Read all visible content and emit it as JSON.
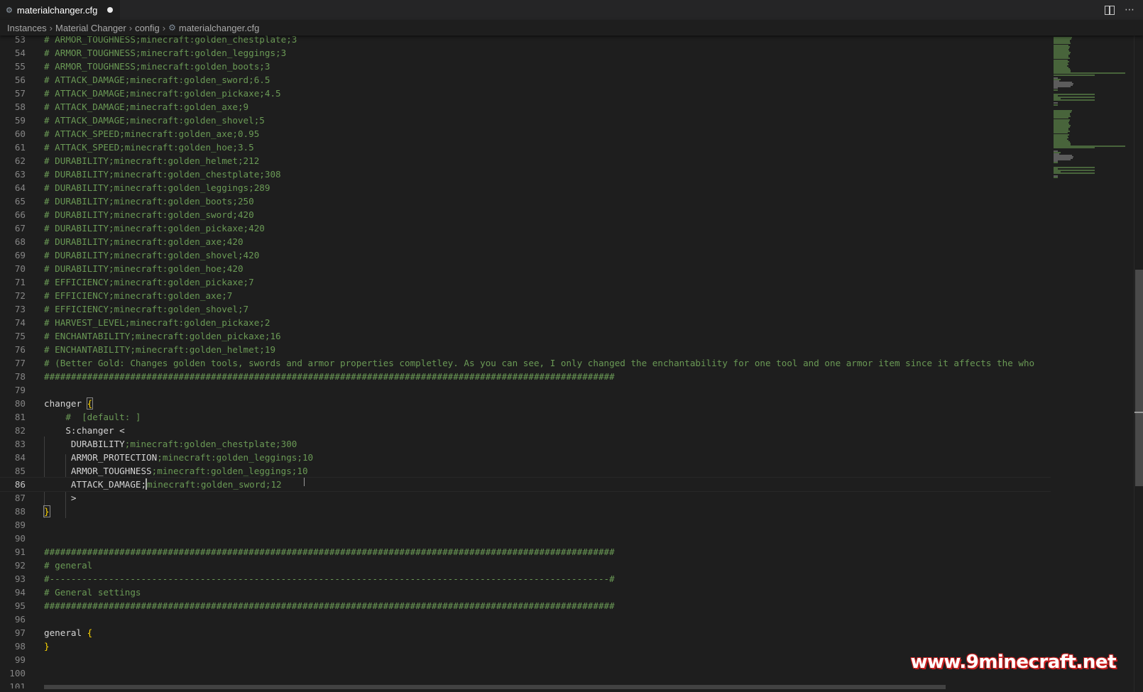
{
  "tab": {
    "label": "materialchanger.cfg",
    "unsaved": true
  },
  "breadcrumb": [
    "Instances",
    "Material Changer",
    "config",
    "materialchanger.cfg"
  ],
  "editor": {
    "current_line": 86,
    "lines": [
      {
        "n": "53",
        "tokens": [
          {
            "t": "# ARMOR_TOUGHNESS;minecraft:golden_chestplate;3",
            "c": "comment"
          }
        ]
      },
      {
        "n": "54",
        "tokens": [
          {
            "t": "# ARMOR_TOUGHNESS;minecraft:golden_leggings;3",
            "c": "comment"
          }
        ]
      },
      {
        "n": "55",
        "tokens": [
          {
            "t": "# ARMOR_TOUGHNESS;minecraft:golden_boots;3",
            "c": "comment"
          }
        ]
      },
      {
        "n": "56",
        "tokens": [
          {
            "t": "# ATTACK_DAMAGE;minecraft:golden_sword;6.5",
            "c": "comment"
          }
        ]
      },
      {
        "n": "57",
        "tokens": [
          {
            "t": "# ATTACK_DAMAGE;minecraft:golden_pickaxe;4.5",
            "c": "comment"
          }
        ]
      },
      {
        "n": "58",
        "tokens": [
          {
            "t": "# ATTACK_DAMAGE;minecraft:golden_axe;9",
            "c": "comment"
          }
        ]
      },
      {
        "n": "59",
        "tokens": [
          {
            "t": "# ATTACK_DAMAGE;minecraft:golden_shovel;5",
            "c": "comment"
          }
        ]
      },
      {
        "n": "60",
        "tokens": [
          {
            "t": "# ATTACK_SPEED;minecraft:golden_axe;0.95",
            "c": "comment"
          }
        ]
      },
      {
        "n": "61",
        "tokens": [
          {
            "t": "# ATTACK_SPEED;minecraft:golden_hoe;3.5",
            "c": "comment"
          }
        ]
      },
      {
        "n": "62",
        "tokens": [
          {
            "t": "# DURABILITY;minecraft:golden_helmet;212",
            "c": "comment"
          }
        ]
      },
      {
        "n": "63",
        "tokens": [
          {
            "t": "# DURABILITY;minecraft:golden_chestplate;308",
            "c": "comment"
          }
        ]
      },
      {
        "n": "64",
        "tokens": [
          {
            "t": "# DURABILITY;minecraft:golden_leggings;289",
            "c": "comment"
          }
        ]
      },
      {
        "n": "65",
        "tokens": [
          {
            "t": "# DURABILITY;minecraft:golden_boots;250",
            "c": "comment"
          }
        ]
      },
      {
        "n": "66",
        "tokens": [
          {
            "t": "# DURABILITY;minecraft:golden_sword;420",
            "c": "comment"
          }
        ]
      },
      {
        "n": "67",
        "tokens": [
          {
            "t": "# DURABILITY;minecraft:golden_pickaxe;420",
            "c": "comment"
          }
        ]
      },
      {
        "n": "68",
        "tokens": [
          {
            "t": "# DURABILITY;minecraft:golden_axe;420",
            "c": "comment"
          }
        ]
      },
      {
        "n": "69",
        "tokens": [
          {
            "t": "# DURABILITY;minecraft:golden_shovel;420",
            "c": "comment"
          }
        ]
      },
      {
        "n": "70",
        "tokens": [
          {
            "t": "# DURABILITY;minecraft:golden_hoe;420",
            "c": "comment"
          }
        ]
      },
      {
        "n": "71",
        "tokens": [
          {
            "t": "# EFFICIENCY;minecraft:golden_pickaxe;7",
            "c": "comment"
          }
        ]
      },
      {
        "n": "72",
        "tokens": [
          {
            "t": "# EFFICIENCY;minecraft:golden_axe;7",
            "c": "comment"
          }
        ]
      },
      {
        "n": "73",
        "tokens": [
          {
            "t": "# EFFICIENCY;minecraft:golden_shovel;7",
            "c": "comment"
          }
        ]
      },
      {
        "n": "74",
        "tokens": [
          {
            "t": "# HARVEST_LEVEL;minecraft:golden_pickaxe;2",
            "c": "comment"
          }
        ]
      },
      {
        "n": "75",
        "tokens": [
          {
            "t": "# ENCHANTABILITY;minecraft:golden_pickaxe;16",
            "c": "comment"
          }
        ]
      },
      {
        "n": "76",
        "tokens": [
          {
            "t": "# ENCHANTABILITY;minecraft:golden_helmet;19",
            "c": "comment"
          }
        ]
      },
      {
        "n": "77",
        "tokens": [
          {
            "t": "# (Better Gold: Changes golden tools, swords and armor properties completley. As you can see, I only changed the enchantability for one tool and one armor item since it affects the who",
            "c": "comment"
          }
        ]
      },
      {
        "n": "78",
        "tokens": [
          {
            "t": "##########################################################################################################",
            "c": "comment"
          }
        ]
      },
      {
        "n": "79",
        "tokens": []
      },
      {
        "n": "80",
        "tokens": [
          {
            "t": "changer ",
            "c": "key"
          },
          {
            "t": "{",
            "c": "brace-match"
          }
        ]
      },
      {
        "n": "81",
        "tokens": [
          {
            "t": "    #  [default: ]",
            "c": "comment"
          }
        ]
      },
      {
        "n": "82",
        "tokens": [
          {
            "t": "    S:changer <",
            "c": "key"
          }
        ]
      },
      {
        "n": "83",
        "tokens": [
          {
            "t": "     DURABILITY",
            "c": "key"
          },
          {
            "t": ";minecraft:golden_chestplate;300",
            "c": "value"
          }
        ]
      },
      {
        "n": "84",
        "tokens": [
          {
            "t": "     ARMOR_PROTECTION",
            "c": "key"
          },
          {
            "t": ";minecraft:golden_leggings;10",
            "c": "value"
          }
        ]
      },
      {
        "n": "85",
        "tokens": [
          {
            "t": "     ARMOR_TOUGHNESS",
            "c": "key"
          },
          {
            "t": ";minecraft:golden_leggings;10",
            "c": "value"
          }
        ]
      },
      {
        "n": "86",
        "tokens": [
          {
            "t": "     ATTACK_DAMAGE;",
            "c": "key"
          },
          {
            "t": "",
            "c": "cursor"
          },
          {
            "t": "minecraft:golden_sword;12",
            "c": "value"
          }
        ]
      },
      {
        "n": "87",
        "tokens": [
          {
            "t": "     >",
            "c": "key"
          }
        ]
      },
      {
        "n": "88",
        "tokens": [
          {
            "t": "}",
            "c": "brace-match"
          }
        ]
      },
      {
        "n": "89",
        "tokens": []
      },
      {
        "n": "90",
        "tokens": []
      },
      {
        "n": "91",
        "tokens": [
          {
            "t": "##########################################################################################################",
            "c": "comment"
          }
        ]
      },
      {
        "n": "92",
        "tokens": [
          {
            "t": "# general",
            "c": "comment"
          }
        ]
      },
      {
        "n": "93",
        "tokens": [
          {
            "t": "#--------------------------------------------------------------------------------------------------------#",
            "c": "comment"
          }
        ]
      },
      {
        "n": "94",
        "tokens": [
          {
            "t": "# General settings",
            "c": "comment"
          }
        ]
      },
      {
        "n": "95",
        "tokens": [
          {
            "t": "##########################################################################################################",
            "c": "comment"
          }
        ]
      },
      {
        "n": "96",
        "tokens": []
      },
      {
        "n": "97",
        "tokens": [
          {
            "t": "general ",
            "c": "key"
          },
          {
            "t": "{",
            "c": "brace"
          }
        ]
      },
      {
        "n": "98",
        "tokens": [
          {
            "t": "}",
            "c": "brace"
          }
        ]
      },
      {
        "n": "99",
        "tokens": []
      },
      {
        "n": "100",
        "tokens": []
      },
      {
        "n": "101",
        "tokens": []
      }
    ]
  },
  "watermark": "www.9minecraft.net",
  "icons": {
    "tab": "gear-icon",
    "breadcrumb_file": "gear-icon",
    "split": "split-editor-icon",
    "more": "more-actions-icon"
  },
  "colors": {
    "background": "#1e1e1e",
    "comment": "#6a9955",
    "text": "#d4d4d4",
    "brace": "#ffd700"
  }
}
